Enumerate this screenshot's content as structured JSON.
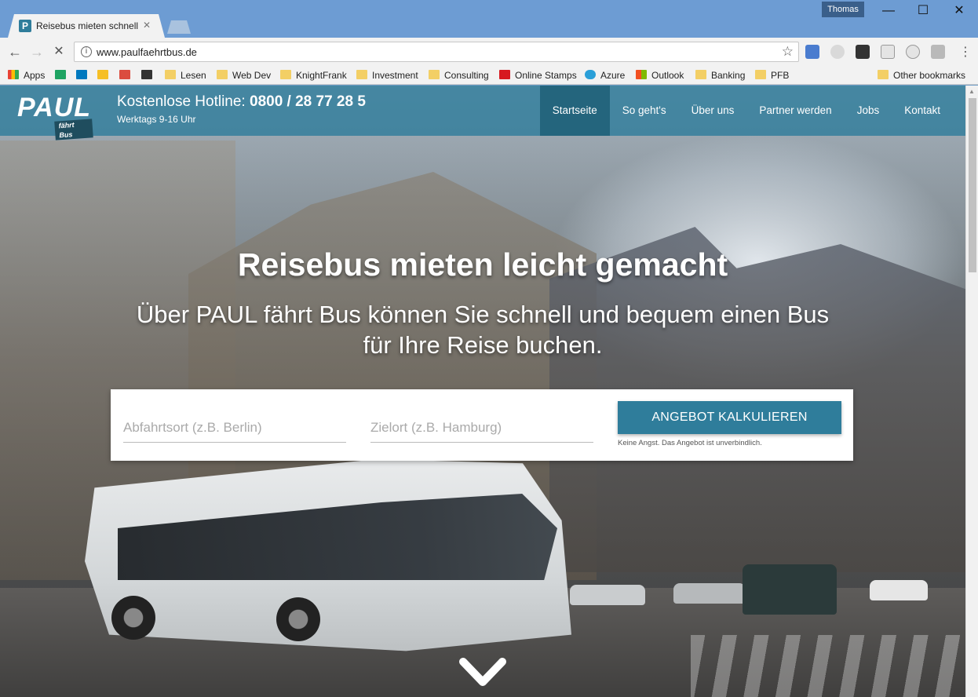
{
  "browser": {
    "tab_title": "Reisebus mieten schnell",
    "tab_favicon": "P",
    "url": "www.paulfaehrtbus.de",
    "user": "Thomas",
    "bookmarks": [
      "Apps",
      "Lesen",
      "Web Dev",
      "KnightFrank",
      "Investment",
      "Consulting",
      "Online Stamps",
      "Azure",
      "Outlook",
      "Banking",
      "PFB",
      "Other bookmarks"
    ]
  },
  "site": {
    "logo": "PAUL",
    "logo_sub": "fährt Bus",
    "hotline_label": "Kostenlose Hotline:",
    "hotline_number": "0800 / 28 77 28 5",
    "hours": "Werktags 9-16 Uhr",
    "nav": [
      "Startseite",
      "So geht's",
      "Über uns",
      "Partner werden",
      "Jobs",
      "Kontakt"
    ],
    "active_nav": "Startseite"
  },
  "hero": {
    "title": "Reisebus mieten leicht gemacht",
    "subtitle": "Über PAUL fährt Bus können Sie schnell und bequem einen Bus für Ihre Reise buchen."
  },
  "form": {
    "from_placeholder": "Abfahrtsort (z.B. Berlin)",
    "to_placeholder": "Zielort (z.B. Hamburg)",
    "button": "ANGEBOT KALKULIEREN",
    "disclaimer": "Keine Angst. Das Angebot ist unverbindlich."
  },
  "icons": {
    "scroll_down": "chevron-down-icon"
  },
  "colors": {
    "brand": "#2f7d9b",
    "brand_dark": "#24657d"
  }
}
